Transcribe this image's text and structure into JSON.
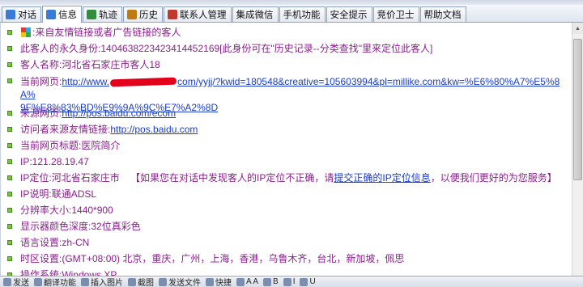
{
  "tabs": [
    {
      "label": "对话",
      "icon": "dialog-icon",
      "color": "#3a7bd5",
      "active": false
    },
    {
      "label": "信息",
      "icon": "info-icon",
      "color": "#3a7bd5",
      "active": true
    },
    {
      "label": "轨迹",
      "icon": "track-icon",
      "color": "#2f8f3a",
      "active": false
    },
    {
      "label": "历史",
      "icon": "history-icon",
      "color": "#c07a12",
      "active": false
    },
    {
      "label": "联系人管理",
      "icon": "contacts-icon",
      "color": "#c0392b",
      "active": false
    },
    {
      "label": "集成微信",
      "icon": "",
      "color": "",
      "active": false
    },
    {
      "label": "手机功能",
      "icon": "",
      "color": "",
      "active": false
    },
    {
      "label": "安全提示",
      "icon": "",
      "color": "",
      "active": false
    },
    {
      "label": "竞价卫士",
      "icon": "",
      "color": "",
      "active": false
    },
    {
      "label": "帮助文档",
      "icon": "",
      "color": "",
      "active": false
    }
  ],
  "info": {
    "source_prefix": ":来自友情链接或者广告链接的客人",
    "perm_id_label": "此客人的永久身份: ",
    "perm_id_value": "140463822342341445 2169",
    "perm_id_note": " [此身份可在\"历史记录--分类查找\"里来定位此客人]",
    "name_label": "客人名称:",
    "name_value": "河北省石家庄市客人18",
    "url_label": "当前网页:",
    "url_part1": "http://www.",
    "url_part2": "com/yyjj/?kwid=180548&creative=105603994&pl=millike.com&kw=%E6%80%A7%E5%8A%",
    "url_part3": "9F%E8%83%BD%E9%9A%9C%E7%A2%8D",
    "source_label": "来源网页:",
    "source_url": "http://pos.baidu.com/ecom",
    "referrer_label": "访问者来源友情链接:",
    "referrer_url": "http://pos.baidu.com",
    "title_label": "当前网页标题:",
    "title_value": "医院简介",
    "ip_label": "IP:",
    "ip_value": "121.28.19.47",
    "ip_loc_label": "IP定位:",
    "ip_loc_value": "河北省石家庄市",
    "ip_loc_note_a": "    【如果您在对话中发现客人的IP定位不正确，请",
    "ip_loc_link": "提交正确的IP定位信息",
    "ip_loc_note_b": "，以便我们更好的为您服务】",
    "ip_desc_label": "IP说明:",
    "ip_desc_value": "联通ADSL",
    "resolution_label": "分辨率大小:",
    "resolution_value": "1440*900",
    "color_depth_label": "显示器颜色深度:",
    "color_depth_value": "32位真彩色",
    "language_label": "语言设置:",
    "language_value": "zh-CN",
    "timezone_label": "时区设置:",
    "timezone_value": "(GMT+08:00) 北京，重庆，广州，上海，香港，乌鲁木齐，台北，新加坡，佩思",
    "os_label": "操作系统:",
    "os_value": "Windows XP"
  },
  "toolbar": [
    {
      "label": "发送",
      "icon": "send-icon"
    },
    {
      "label": "翻译功能",
      "icon": "translate-icon"
    },
    {
      "label": "插入图片",
      "icon": "image-icon"
    },
    {
      "label": "截图",
      "icon": "screenshot-icon"
    },
    {
      "label": "发送文件",
      "icon": "file-icon"
    },
    {
      "label": "快捷",
      "icon": "quick-icon"
    },
    {
      "label": "A A",
      "icon": "font-icon"
    },
    {
      "label": "B",
      "icon": "bold-icon"
    },
    {
      "label": "I",
      "icon": "italic-icon"
    },
    {
      "label": "U",
      "icon": "underline-icon"
    }
  ]
}
